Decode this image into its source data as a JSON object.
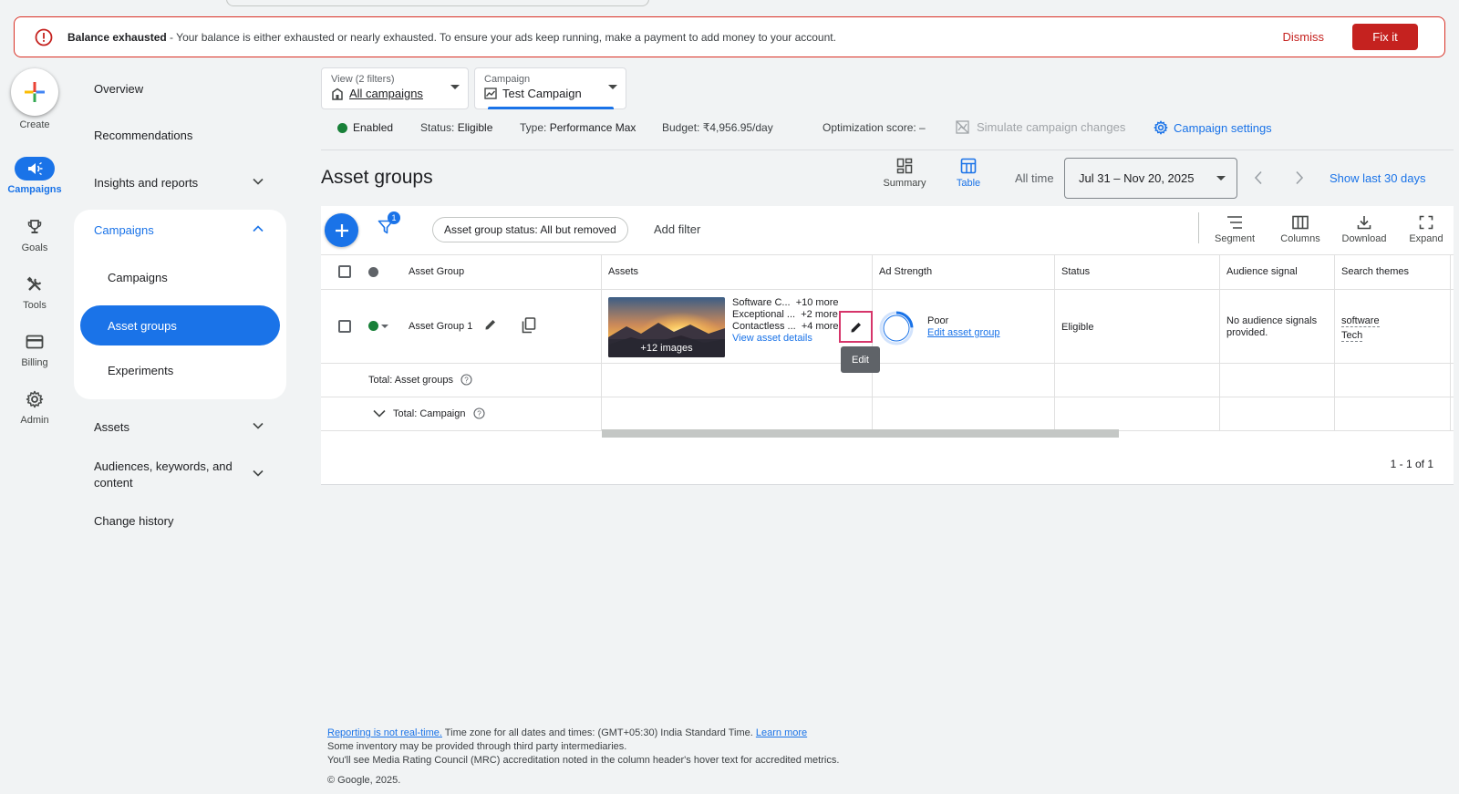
{
  "banner": {
    "title": "Balance exhausted",
    "message": " - Your balance is either exhausted or nearly exhausted. To ensure your ads keep running, make a payment to add money to your account.",
    "dismiss": "Dismiss",
    "fix": "Fix it"
  },
  "rail": {
    "create": "Create",
    "campaigns": "Campaigns",
    "goals": "Goals",
    "tools": "Tools",
    "billing": "Billing",
    "admin": "Admin"
  },
  "nav": {
    "overview": "Overview",
    "recommendations": "Recommendations",
    "insights": "Insights and reports",
    "campaigns_header": "Campaigns",
    "campaigns_sub": "Campaigns",
    "asset_groups": "Asset groups",
    "experiments": "Experiments",
    "assets": "Assets",
    "audiences_line1": "Audiences, keywords, and",
    "audiences_line2": "content",
    "change_history": "Change history"
  },
  "selectors": {
    "view_label": "View (2 filters)",
    "view_value": "All campaigns",
    "campaign_label": "Campaign",
    "campaign_value": "Test Campaign"
  },
  "status": {
    "enabled": "Enabled",
    "status_label": "Status:",
    "status_value": "Eligible",
    "type_label": "Type:",
    "type_value": "Performance Max",
    "budget": "Budget: ₹4,956.95/day",
    "optimization": "Optimization score: –",
    "simulate": "Simulate campaign changes",
    "settings": "Campaign settings"
  },
  "header": {
    "title": "Asset groups",
    "summary": "Summary",
    "table": "Table",
    "all_time": "All time",
    "date_range": "Jul 31 – Nov 20, 2025",
    "show_last": "Show last 30 days"
  },
  "toolbar": {
    "filter_badge": "1",
    "chip": "Asset group status: All but removed",
    "add_filter": "Add filter",
    "segment": "Segment",
    "columns": "Columns",
    "download": "Download",
    "expand": "Expand"
  },
  "table": {
    "columns": [
      "Asset Group",
      "Assets",
      "Ad Strength",
      "Status",
      "Audience signal",
      "Search themes"
    ],
    "row": {
      "name": "Asset Group 1",
      "images_caption": "+12 images",
      "asset_lines": [
        {
          "text": "Software C...",
          "more": "+10 more"
        },
        {
          "text": "Exceptional ...",
          "more": "+2 more"
        },
        {
          "text": "Contactless ...",
          "more": "+4 more"
        }
      ],
      "view_details": "View asset details",
      "edit_tooltip": "Edit",
      "strength": "Poor",
      "edit_group": "Edit asset group",
      "status": "Eligible",
      "audience_line1": "No audience signals",
      "audience_line2": "provided.",
      "theme1": "software",
      "theme2": "Tech"
    },
    "total_groups": "Total: Asset groups",
    "total_campaign": "Total: Campaign",
    "pagination": "1 - 1 of 1"
  },
  "footer": {
    "reporting_link": "Reporting is not real-time.",
    "timezone": " Time zone for all dates and times: (GMT+05:30) India Standard Time. ",
    "learn_more": "Learn more",
    "line2": "Some inventory may be provided through third party intermediaries.",
    "line3": "You'll see Media Rating Council (MRC) accreditation noted in the column header's hover text for accredited metrics.",
    "copyright": "© Google, 2025."
  },
  "colors": {
    "brand_blue": "#1a73e8",
    "error_red": "#c5221f",
    "enabled_green": "#188038"
  }
}
